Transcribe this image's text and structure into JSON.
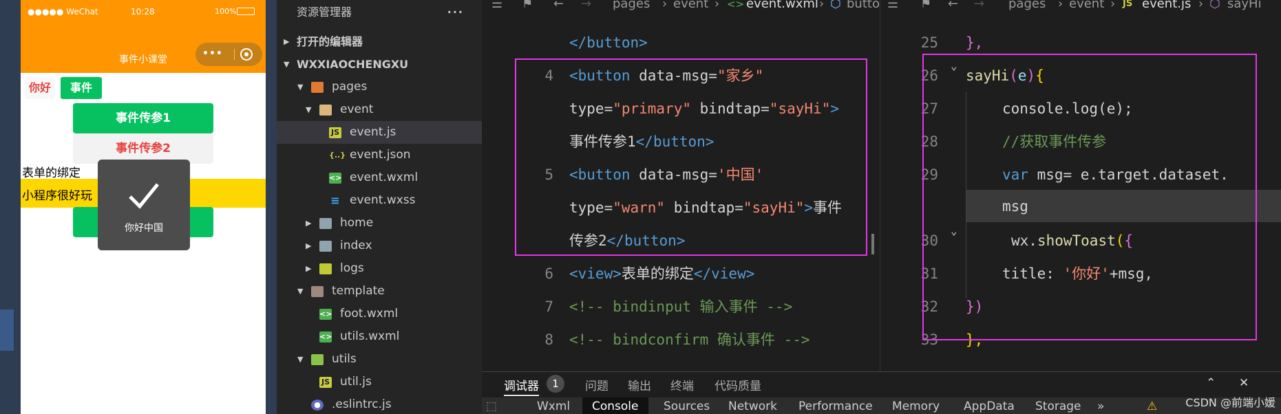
{
  "simulator": {
    "status": {
      "carrier": "●●●●● WeChat",
      "time": "10:28",
      "battery": "100%"
    },
    "nav_title": "事件小课堂",
    "capsule_dots": "•••",
    "mini_buttons": {
      "hello": "你好",
      "event": "事件"
    },
    "buttons": {
      "primary": "事件传参1",
      "warn": "事件传参2"
    },
    "texts": {
      "binding": "表单的绑定",
      "fun": "小程序很好玩"
    },
    "toast": {
      "text": "你好中国"
    }
  },
  "explorer": {
    "title": "资源管理器",
    "more": "···",
    "open_editors": "打开的编辑器",
    "project": "WXXIAOCHENGXU",
    "items": [
      {
        "label": "pages",
        "kind": "folder-open"
      },
      {
        "label": "event",
        "kind": "folder-open"
      },
      {
        "label": "event.js",
        "kind": "js"
      },
      {
        "label": "event.json",
        "kind": "json"
      },
      {
        "label": "event.wxml",
        "kind": "wxml"
      },
      {
        "label": "event.wxss",
        "kind": "wxss"
      },
      {
        "label": "home",
        "kind": "folder"
      },
      {
        "label": "index",
        "kind": "folder"
      },
      {
        "label": "logs",
        "kind": "folder"
      },
      {
        "label": "template",
        "kind": "folder-open"
      },
      {
        "label": "foot.wxml",
        "kind": "wxml"
      },
      {
        "label": "utils.wxml",
        "kind": "wxml"
      },
      {
        "label": "utils",
        "kind": "folder-open"
      },
      {
        "label": "util.js",
        "kind": "js"
      },
      {
        "label": ".eslintrc.js",
        "kind": "eslint"
      }
    ]
  },
  "wxml_editor": {
    "breadcrumb": {
      "p1": "pages",
      "p2": "event",
      "file": "event.wxml",
      "sym": "button"
    },
    "line_numbers": {
      "l4": "4",
      "l5": "5",
      "l6": "6",
      "l7": "7",
      "l8": "8"
    },
    "code": {
      "c0": "</button>",
      "c1a": "<button",
      "c1b": " data-msg=",
      "c1c": "\"家乡\"",
      "c2a": "type=",
      "c2b": "\"primary\"",
      "c2c": " bindtap=",
      "c2d": "\"sayHi\"",
      "c2e": ">",
      "c3a": "事件传参1",
      "c3b": "</button>",
      "c4a": "<button",
      "c4b": " data-msg=",
      "c4c": "'中国'",
      "c5a": "type=",
      "c5b": "\"warn\"",
      "c5c": " bindtap=",
      "c5d": "\"sayHi\"",
      "c5e": ">",
      "c5f": "事件",
      "c6a": "传参2",
      "c6b": "</button>",
      "c7a": "<view>",
      "c7b": "表单的绑定",
      "c7c": "</view>",
      "c8": "<!-- bindinput 输入事件 -->",
      "c9": "<!-- bindconfirm 确认事件 -->"
    }
  },
  "js_editor": {
    "breadcrumb": {
      "p1": "pages",
      "p2": "event",
      "file": "event.js",
      "sym": "sayHi"
    },
    "line_numbers": {
      "l25": "25",
      "l26": "26",
      "l27": "27",
      "l28": "28",
      "l29": "29",
      "l30": "30",
      "l31": "31",
      "l32": "32",
      "l33": "33"
    },
    "code": {
      "j0": "},",
      "j1a": "sayHi",
      "j1b": "(",
      "j1c": "e",
      "j1d": ")",
      "j1e": "{",
      "j2": "console.log(e);",
      "j3": "//获取事件传参",
      "j4a": "var",
      "j4b": " msg= ",
      "j4c": "e.target.dataset.",
      "j5": "msg",
      "j6a": "wx.",
      "j6b": "showToast",
      "j6c": "(",
      "j6d": "{",
      "j7a": "title: ",
      "j7b": "'你好'",
      "j7c": "+msg,",
      "j8": "})",
      "j9": "},"
    }
  },
  "panel": {
    "tabs": {
      "debugger": "调试器",
      "badge": "1",
      "problems": "问题",
      "output": "输出",
      "terminal": "终端",
      "quality": "代码质量"
    },
    "subtabs": {
      "wxml": "Wxml",
      "console": "Console",
      "sources": "Sources",
      "network": "Network",
      "performance": "Performance",
      "memory": "Memory",
      "appdata": "AppData",
      "storage": "Storage"
    }
  },
  "watermark": "CSDN @前端小媛"
}
